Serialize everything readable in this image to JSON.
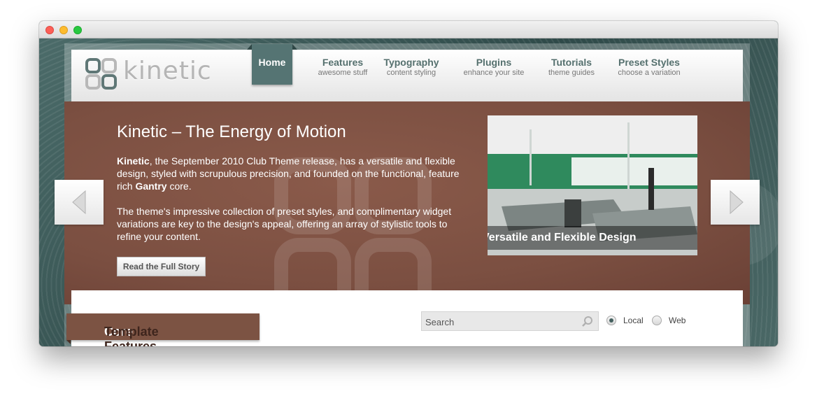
{
  "window": {
    "controls": [
      "close",
      "minimize",
      "zoom"
    ]
  },
  "logo": {
    "text": "kinetic",
    "icon": "kinetic-logo-icon"
  },
  "nav": {
    "home": "Home",
    "items": [
      {
        "title": "Features",
        "subtitle": "awesome stuff"
      },
      {
        "title": "Typography",
        "subtitle": "content styling"
      },
      {
        "title": "Plugins",
        "subtitle": "enhance your site"
      },
      {
        "title": "Tutorials",
        "subtitle": "theme guides"
      },
      {
        "title": "Preset Styles",
        "subtitle": "choose a variation"
      }
    ]
  },
  "hero": {
    "title": "Kinetic – The Energy of Motion",
    "p1_strong1": "Kinetic",
    "p1_text1": ", the September 2010 Club Theme release, has a versatile and flexible design, styled with scrupulous precision, and founded on the functional, feature rich ",
    "p1_strong2": "Gantry",
    "p1_text2": " core.",
    "p2": "The theme's impressive collection of preset styles, and complimentary widget variations are key to the design's appeal, offering an array of stylistic tools to refine your content.",
    "button": "Read the Full Story",
    "image_caption": "Versatile and Flexible Design",
    "prev_icon": "triangle-left-icon",
    "next_icon": "triangle-right-icon"
  },
  "content": {
    "banner_strong": "Core",
    "banner_rest": " Template Features",
    "search_placeholder": "Search",
    "radio_local": "Local",
    "radio_web": "Web"
  },
  "colors": {
    "accent": "#557473",
    "hero_bg": "#7b4f41",
    "banner_bg": "#7c5343"
  }
}
